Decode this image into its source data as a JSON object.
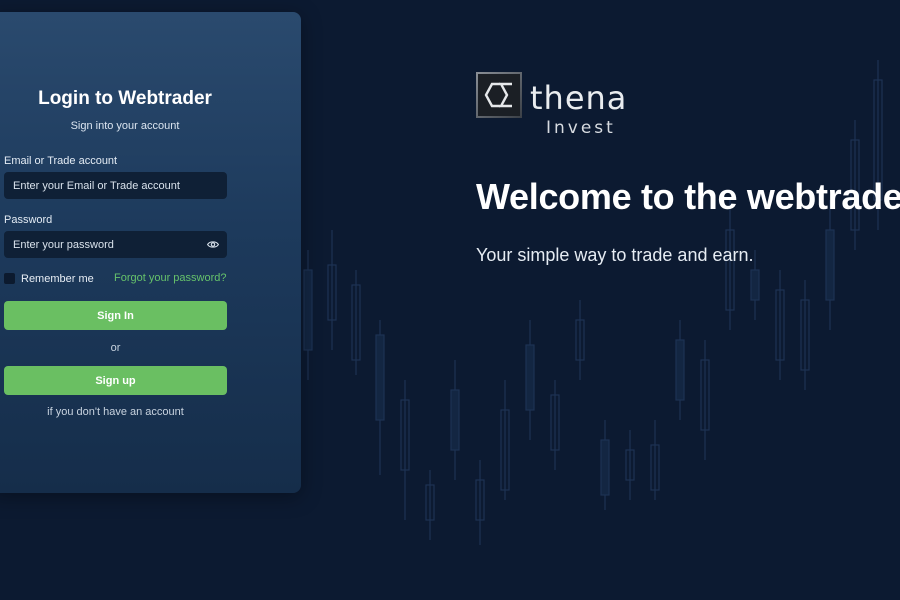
{
  "login": {
    "title": "Login to Webtrader",
    "subtitle": "Sign into your account",
    "email_label": "Email or Trade account",
    "email_placeholder": "Enter your Email or Trade account",
    "password_label": "Password",
    "password_placeholder": "Enter your password",
    "remember_label": "Remember me",
    "forgot_link": "Forgot your password?",
    "signin_button": "Sign In",
    "or_text": "or",
    "signup_button": "Sign up",
    "no_account_text": "if you don't have an account"
  },
  "brand": {
    "wordmark": "thena",
    "subword": "Invest"
  },
  "hero": {
    "title": "Welcome to the webtrader",
    "subtitle": "Your simple way to trade and earn."
  },
  "colors": {
    "background": "#0c1a31",
    "accent_green": "#6abf62",
    "link_green": "#66c26b"
  },
  "icons": {
    "password_toggle": "eye-icon",
    "logo": "sigma-logo-icon"
  }
}
